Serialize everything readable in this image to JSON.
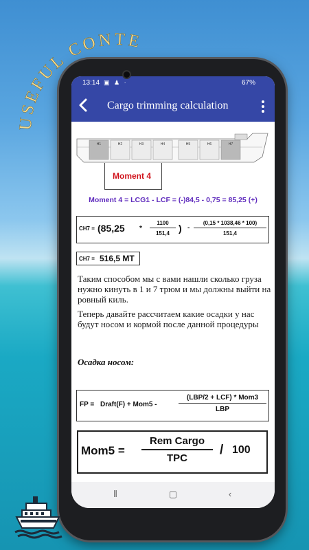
{
  "banner": {
    "curved_title": "USEFUL CONTENT"
  },
  "status_bar": {
    "time": "13:14",
    "battery": "67%"
  },
  "app_bar": {
    "title": "Cargo trimming calculation"
  },
  "diagram": {
    "holds": [
      "H1",
      "H2",
      "H3",
      "H4",
      "H5",
      "H6",
      "H7"
    ],
    "moment_label": "Moment 4"
  },
  "moment_equation": "Moment 4 = LCG1 - LCF = (-)84,5 - 0,75 = 85,25 (+)",
  "formula_ch7": {
    "label": "CH7 =",
    "value": "(85,25",
    "times": "*",
    "frac1_num": "1100",
    "frac1_den": "151,4",
    "close": ")",
    "minus": "-",
    "frac2_num": "(0,15 * 1038,46 * 100)",
    "frac2_den": "151,4"
  },
  "result_ch7": {
    "label": "CH7 =",
    "value": "516,5 MT"
  },
  "paragraph1": "Таким способом мы с вами нашли сколько груза нужно кинуть в 1 и 7 трюм и мы должны выйти на ровный киль.",
  "paragraph2": "Теперь давайте рассчитаем какие осадки у нас будут носом и кормой после данной процедуры",
  "section_heading": "Осадка носом:",
  "formula_fp": {
    "label": "FP =",
    "part": "Draft(F) + Mom5 -",
    "num": "(LBP/2 + LCF) * Mom3",
    "den": "LBP"
  },
  "formula_mom5": {
    "label": "Mom5 =",
    "num": "Rem Cargo",
    "den": "TPC",
    "slash": "/",
    "divisor": "100"
  },
  "colors": {
    "app_bar": "#3547a6",
    "moment_label": "#d0121b",
    "moment_equation": "#5f2bbd"
  },
  "icons": [
    "back-arrow-icon",
    "overflow-menu-icon",
    "recent-apps-icon",
    "home-icon",
    "back-nav-icon",
    "ship-logo-icon"
  ]
}
